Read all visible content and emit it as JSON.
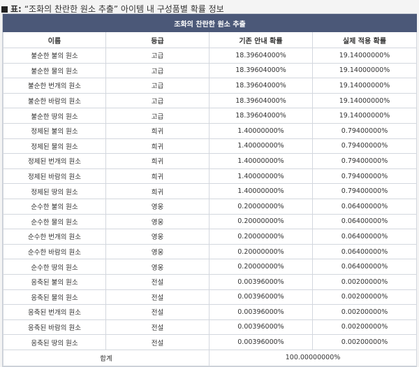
{
  "caption": {
    "prefix": "표:",
    "text": "“조화의 찬란한 원소 추출” 아이템 내 구성품별 확률 정보"
  },
  "table": {
    "title": "조화의 찬란한 원소 추출",
    "headers": [
      "이름",
      "등급",
      "기존 안내 확률",
      "실제 적용 확률"
    ],
    "rows": [
      [
        "불순한 불의 원소",
        "고급",
        "18.39604000%",
        "19.14000000%"
      ],
      [
        "불순한 물의 원소",
        "고급",
        "18.39604000%",
        "19.14000000%"
      ],
      [
        "불순한 번개의 원소",
        "고급",
        "18.39604000%",
        "19.14000000%"
      ],
      [
        "불순한 바람의 원소",
        "고급",
        "18.39604000%",
        "19.14000000%"
      ],
      [
        "불순한 땅의 원소",
        "고급",
        "18.39604000%",
        "19.14000000%"
      ],
      [
        "정제된 불의 원소",
        "희귀",
        "1.40000000%",
        "0.79400000%"
      ],
      [
        "정제된 물의 원소",
        "희귀",
        "1.40000000%",
        "0.79400000%"
      ],
      [
        "정제된 번개의 원소",
        "희귀",
        "1.40000000%",
        "0.79400000%"
      ],
      [
        "정제된 바람의 원소",
        "희귀",
        "1.40000000%",
        "0.79400000%"
      ],
      [
        "정제된 땅의 원소",
        "희귀",
        "1.40000000%",
        "0.79400000%"
      ],
      [
        "순수한 불의 원소",
        "영웅",
        "0.20000000%",
        "0.06400000%"
      ],
      [
        "순수한 물의 원소",
        "영웅",
        "0.20000000%",
        "0.06400000%"
      ],
      [
        "순수한 번개의 원소",
        "영웅",
        "0.20000000%",
        "0.06400000%"
      ],
      [
        "순수한 바람의 원소",
        "영웅",
        "0.20000000%",
        "0.06400000%"
      ],
      [
        "순수한 땅의 원소",
        "영웅",
        "0.20000000%",
        "0.06400000%"
      ],
      [
        "응축된 불의 원소",
        "전설",
        "0.00396000%",
        "0.00200000%"
      ],
      [
        "응축된 물의 원소",
        "전설",
        "0.00396000%",
        "0.00200000%"
      ],
      [
        "응축된 번개의 원소",
        "전설",
        "0.00396000%",
        "0.00200000%"
      ],
      [
        "응축된 바람의 원소",
        "전설",
        "0.00396000%",
        "0.00200000%"
      ],
      [
        "응축된 땅의 원소",
        "전설",
        "0.00396000%",
        "0.00200000%"
      ]
    ],
    "total": {
      "label": "합계",
      "value": "100.00000000%"
    }
  }
}
